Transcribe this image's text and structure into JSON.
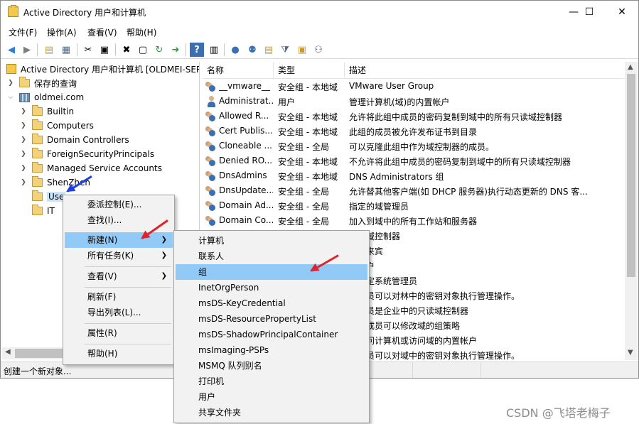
{
  "window": {
    "title": "Active Directory 用户和计算机"
  },
  "window_controls": {
    "minimize": "—",
    "maximize": "☐",
    "close": "✕"
  },
  "menubar": [
    "文件(F)",
    "操作(A)",
    "查看(V)",
    "帮助(H)"
  ],
  "toolbar_icons": [
    "back-icon",
    "forward-icon",
    "up-folder-icon",
    "show-tree-icon",
    "cut-icon",
    "paste-icon",
    "delete-icon",
    "properties-icon",
    "refresh-icon",
    "export-icon",
    "help-icon",
    "console-icon",
    "new-user-icon",
    "new-group-icon",
    "new-ou-icon",
    "filter-icon",
    "find-icon",
    "add-to-group-icon"
  ],
  "tree": {
    "root": "Active Directory 用户和计算机 [OLDMEI-SER",
    "saved_queries": "保存的查询",
    "domain": "oldmei.com",
    "children": [
      "Builtin",
      "Computers",
      "Domain Controllers",
      "ForeignSecurityPrincipals",
      "Managed Service Accounts",
      "ShenZhen",
      "Use",
      "IT"
    ]
  },
  "list": {
    "headers": [
      "名称",
      "类型",
      "描述"
    ],
    "rows": [
      {
        "name": "__vmware__",
        "type": "安全组 - 本地域",
        "desc": "VMware User Group",
        "icon": "group"
      },
      {
        "name": "Administrat...",
        "type": "用户",
        "desc": "管理计算机(域)的内置帐户",
        "icon": "user"
      },
      {
        "name": "Allowed R...",
        "type": "安全组 - 本地域",
        "desc": "允许将此组中成员的密码复制到域中的所有只读域控制器",
        "icon": "group"
      },
      {
        "name": "Cert Publis...",
        "type": "安全组 - 本地域",
        "desc": "此组的成员被允许发布证书到目录",
        "icon": "group"
      },
      {
        "name": "Cloneable ...",
        "type": "安全组 - 全局",
        "desc": "可以克隆此组中作为域控制器的成员。",
        "icon": "group"
      },
      {
        "name": "Denied RO...",
        "type": "安全组 - 本地域",
        "desc": "不允许将此组中成员的密码复制到域中的所有只读域控制器",
        "icon": "group"
      },
      {
        "name": "DnsAdmins",
        "type": "安全组 - 本地域",
        "desc": "DNS Administrators 组",
        "icon": "group"
      },
      {
        "name": "DnsUpdate...",
        "type": "安全组 - 全局",
        "desc": "允许替其他客户端(如 DHCP 服务器)执行动态更新的 DNS 客...",
        "icon": "group"
      },
      {
        "name": "Domain Ad...",
        "type": "安全组 - 全局",
        "desc": "指定的域管理员",
        "icon": "group"
      },
      {
        "name": "Domain Co...",
        "type": "安全组 - 全局",
        "desc": "加入到域中的所有工作站和服务器",
        "icon": "group"
      },
      {
        "name": "",
        "type": "",
        "desc": "所有域控制器",
        "icon": ""
      },
      {
        "name": "",
        "type": "",
        "desc": "所有来宾",
        "icon": ""
      },
      {
        "name": "",
        "type": "",
        "desc": "域用户",
        "icon": ""
      },
      {
        "name": "",
        "type": "",
        "desc": "的指定系统管理员",
        "icon": ""
      },
      {
        "name": "",
        "type": "",
        "desc": "的成员可以对林中的密钥对象执行管理操作。",
        "icon": ""
      },
      {
        "name": "",
        "type": "",
        "desc": "的成员是企业中的只读域控制器",
        "icon": ""
      },
      {
        "name": "",
        "type": "",
        "desc": "中的成员可以修改域的组策略",
        "icon": ""
      },
      {
        "name": "",
        "type": "",
        "desc": "宾访问计算机或访问域的内置帐户",
        "icon": ""
      },
      {
        "name": "",
        "type": "",
        "desc": "的成员可以对域中的密钥对象执行管理操作。",
        "icon": ""
      }
    ]
  },
  "context_menu": {
    "items": [
      "委派控制(E)...",
      "查找(I)...",
      "新建(N)",
      "所有任务(K)",
      "查看(V)",
      "刷新(F)",
      "导出列表(L)...",
      "属性(R)",
      "帮助(H)"
    ]
  },
  "submenu": {
    "items": [
      "计算机",
      "联系人",
      "组",
      "InetOrgPerson",
      "msDS-KeyCredential",
      "msDS-ResourcePropertyList",
      "msDS-ShadowPrincipalContainer",
      "msImaging-PSPs",
      "MSMQ 队列别名",
      "打印机",
      "用户",
      "共享文件夹"
    ]
  },
  "statusbar": {
    "text": "创建一个新对象..."
  },
  "watermark": "CSDN @飞塔老梅子",
  "colors": {
    "highlight": "#91c9f7",
    "annotation_red": "#e0232b",
    "annotation_blue": "#1f3fe0"
  }
}
